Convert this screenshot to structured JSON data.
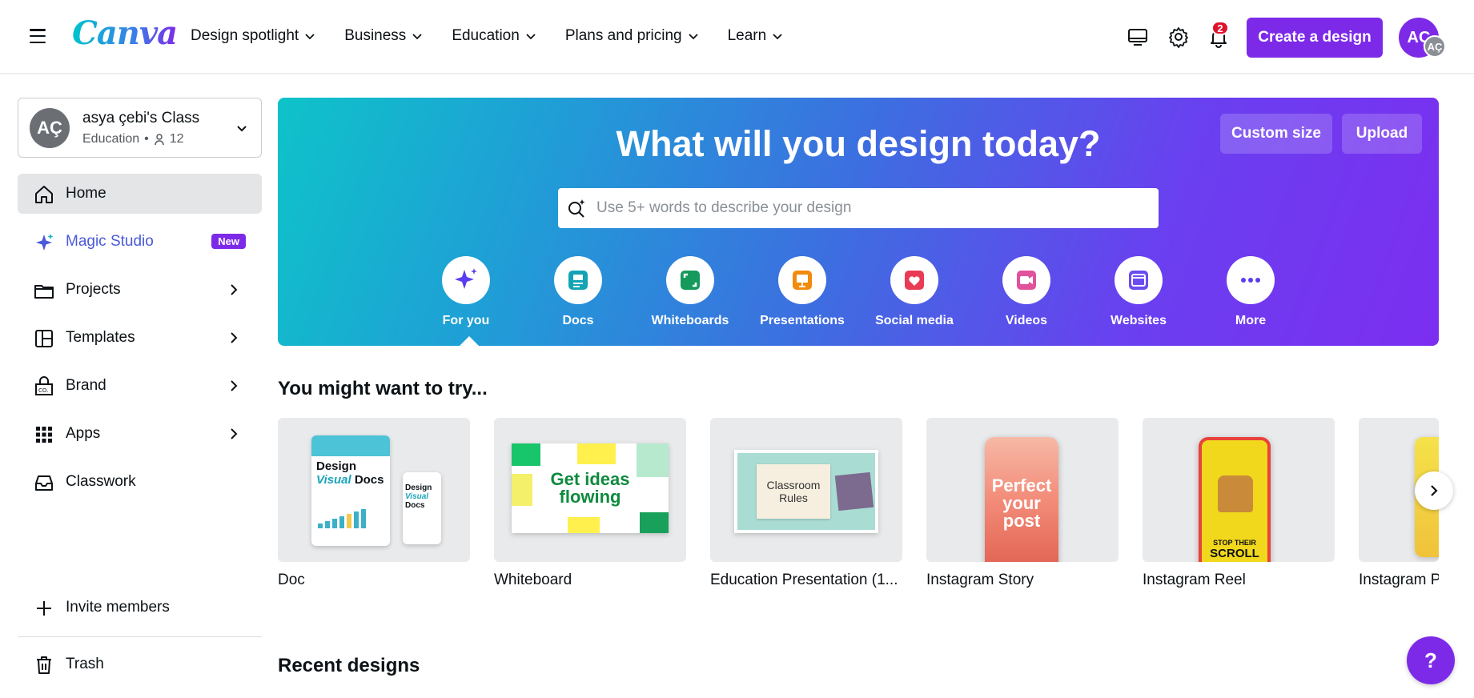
{
  "header": {
    "logo": "Canva",
    "nav": [
      {
        "label": "Design spotlight"
      },
      {
        "label": "Business"
      },
      {
        "label": "Education"
      },
      {
        "label": "Plans and pricing"
      },
      {
        "label": "Learn"
      }
    ],
    "notification_count": "2",
    "create_label": "Create a design",
    "avatar_initials": "AÇ",
    "avatar_mini_initials": "AÇ"
  },
  "sidebar": {
    "team": {
      "initials": "AÇ",
      "name": "asya çebi's Class",
      "type": "Education",
      "separator": "•",
      "members": "12"
    },
    "items": [
      {
        "label": "Home",
        "icon": "home-icon"
      },
      {
        "label": "Magic Studio",
        "icon": "sparkle-icon",
        "badge": "New"
      },
      {
        "label": "Projects",
        "icon": "folder-icon"
      },
      {
        "label": "Templates",
        "icon": "templates-icon"
      },
      {
        "label": "Brand",
        "icon": "brand-icon"
      },
      {
        "label": "Apps",
        "icon": "apps-grid-icon"
      },
      {
        "label": "Classwork",
        "icon": "tray-icon"
      }
    ],
    "invite_label": "Invite members",
    "trash_label": "Trash"
  },
  "hero": {
    "title": "What will you design today?",
    "custom_size_label": "Custom size",
    "upload_label": "Upload",
    "search_placeholder": "Use 5+ words to describe your design",
    "categories": [
      {
        "label": "For you",
        "icon": "sparkle-icon",
        "color": "#5b3cf0"
      },
      {
        "label": "Docs",
        "icon": "doc-icon",
        "color": "#13a3b5"
      },
      {
        "label": "Whiteboards",
        "icon": "whiteboard-icon",
        "color": "#159a5c"
      },
      {
        "label": "Presentations",
        "icon": "presentation-icon",
        "color": "#f28a0c"
      },
      {
        "label": "Social media",
        "icon": "heart-icon",
        "color": "#ea3b55"
      },
      {
        "label": "Videos",
        "icon": "video-icon",
        "color": "#e2519b"
      },
      {
        "label": "Websites",
        "icon": "website-icon",
        "color": "#6a4cf0"
      },
      {
        "label": "More",
        "icon": "more-icon",
        "color": "#5b3cf0"
      }
    ]
  },
  "try_section": {
    "title": "You might want to try...",
    "cards": [
      {
        "label": "Doc",
        "thumb_text_1": "Design",
        "thumb_text_2": "Visual",
        "thumb_text_3": "Docs"
      },
      {
        "label": "Whiteboard",
        "thumb_text_1": "Get ideas",
        "thumb_text_2": "flowing"
      },
      {
        "label": "Education Presentation (1...",
        "thumb_text_1": "Classroom",
        "thumb_text_2": "Rules"
      },
      {
        "label": "Instagram Story",
        "thumb_text_1": "Perfect",
        "thumb_text_2": "your",
        "thumb_text_3": "post"
      },
      {
        "label": "Instagram Reel",
        "thumb_text_1": "STOP THEIR",
        "thumb_text_2": "SCROLL"
      },
      {
        "label": "Instagram P"
      }
    ]
  },
  "recent": {
    "title": "Recent designs"
  },
  "help_label": "?",
  "colors": {
    "brand_purple": "#7d2ae8",
    "magic_blue": "#4a59d9"
  }
}
